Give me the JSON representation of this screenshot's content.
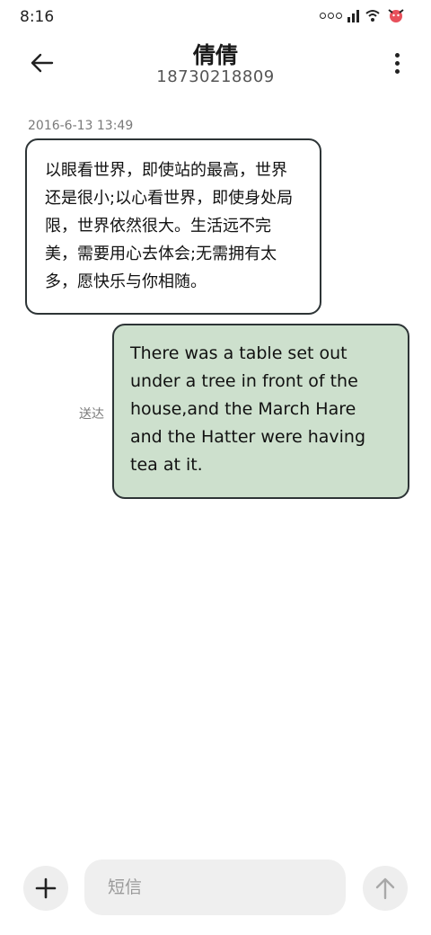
{
  "status_bar": {
    "time": "8:16",
    "icons": [
      "signal-icon",
      "wifi-icon",
      "battery-icon"
    ]
  },
  "header": {
    "contact_name": "倩倩",
    "contact_number": "18730218809",
    "back_icon": "arrow-left-icon",
    "more_icon": "more-vertical-icon"
  },
  "conversation": {
    "timestamp": "2016-6-13 13:49",
    "received_message": "以眼看世界，即使站的最高，世界还是很小;以心看世界，即使身处局限，世界依然很大。生活远不完美，需要用心去体会;无需拥有太多，愿快乐与你相随。",
    "sent_message": "There was a table set out under a tree in front of the house,and the March Hare and the Hatter were having tea at it.",
    "sent_status": "送达"
  },
  "composer": {
    "placeholder": "短信",
    "value": "",
    "add_icon": "plus-icon",
    "send_icon": "arrow-up-icon"
  },
  "colors": {
    "sent_bubble": "#cde0cd",
    "received_bubble": "#ffffff",
    "bubble_border": "#2d3436",
    "input_background": "#efefef"
  }
}
